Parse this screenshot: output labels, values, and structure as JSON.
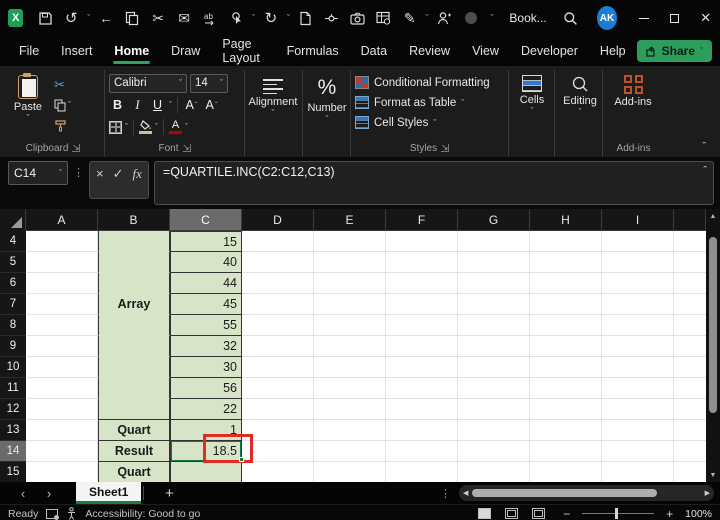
{
  "titlebar": {
    "title": "Book...",
    "avatar_initials": "AK",
    "logo_letter": "X"
  },
  "tabs": {
    "items": [
      "File",
      "Insert",
      "Home",
      "Draw",
      "Page Layout",
      "Formulas",
      "Data",
      "Review",
      "View",
      "Developer",
      "Help"
    ],
    "active": "Home",
    "share": "Share"
  },
  "ribbon": {
    "clipboard": {
      "paste": "Paste",
      "label": "Clipboard"
    },
    "font": {
      "name": "Calibri",
      "size": "14",
      "bold": "B",
      "italic": "I",
      "underline": "U",
      "grow": "A",
      "shrink": "A",
      "color_letter": "A",
      "label": "Font"
    },
    "alignment": {
      "title": "Alignment"
    },
    "number": {
      "title": "Number",
      "icon": "%"
    },
    "styles": {
      "conditional_formatting": "Conditional Formatting",
      "format_as_table": "Format as Table",
      "cell_styles": "Cell Styles",
      "label": "Styles"
    },
    "cells": {
      "title": "Cells"
    },
    "editing": {
      "title": "Editing"
    },
    "addins": {
      "title": "Add-ins",
      "label": "Add-ins"
    }
  },
  "formula_bar": {
    "name_box": "C14",
    "cancel": "×",
    "enter": "✓",
    "fx": "fx",
    "formula": "=QUARTILE.INC(C2:C12,C13)"
  },
  "grid": {
    "columns": [
      "A",
      "B",
      "C",
      "D",
      "E",
      "F",
      "G",
      "H",
      "I"
    ],
    "selected_column": "C",
    "selected_row": "14",
    "selected_cell": "C14",
    "rows": [
      {
        "n": "4",
        "b": "",
        "c": "15"
      },
      {
        "n": "5",
        "b": "",
        "c": "40"
      },
      {
        "n": "6",
        "b": "",
        "c": "44"
      },
      {
        "n": "7",
        "b": "Array",
        "c": "45"
      },
      {
        "n": "8",
        "b": "",
        "c": "55"
      },
      {
        "n": "9",
        "b": "",
        "c": "32"
      },
      {
        "n": "10",
        "b": "",
        "c": "30"
      },
      {
        "n": "11",
        "b": "",
        "c": "56"
      },
      {
        "n": "12",
        "b": "",
        "c": "22"
      },
      {
        "n": "13",
        "b": "Quart",
        "c": "1"
      },
      {
        "n": "14",
        "b": "Result",
        "c": "18.5"
      },
      {
        "n": "15",
        "b": "Quart",
        "c": ""
      }
    ]
  },
  "sheetbar": {
    "sheet": "Sheet1",
    "add": "+"
  },
  "statusbar": {
    "ready": "Ready",
    "accessibility": "Accessibility: Good to go",
    "zoom_out": "−",
    "zoom_in": "+",
    "zoom": "100%"
  },
  "icons": {
    "undo": "↺",
    "redo": "↻",
    "back": "←",
    "cut": "✂",
    "mail": "✉",
    "pen": "✎",
    "chevron_down": "ˇ",
    "chevron_up": "ˆ",
    "more_dots": "⋮",
    "nav_prev": "‹",
    "nav_next": "›",
    "tri_up": "▲",
    "tri_down": "▼",
    "tri_left": "◀",
    "tri_right": "▶",
    "close": "×",
    "launcher": "↘"
  },
  "colors": {
    "accent_green": "#107C41",
    "share_green": "#2d9d5c",
    "cell_fill_green": "#d8e4c8",
    "annotation_red": "#e02b22",
    "avatar_blue": "#1a7fd4"
  }
}
